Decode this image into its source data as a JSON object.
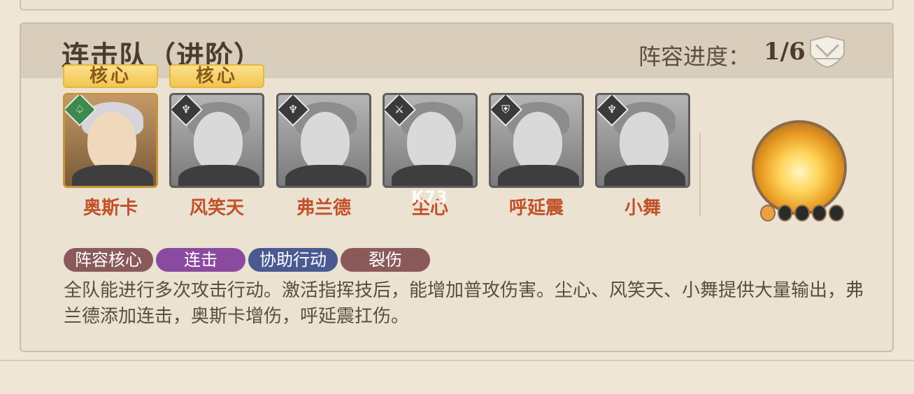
{
  "lineup": {
    "title": "连击队（进阶）",
    "progress_label": "阵容进度：",
    "progress_value": "1/6",
    "badge_icon": "shield-crest-icon"
  },
  "core_tag_label": "核心",
  "heroes": [
    {
      "name": "奥斯卡",
      "active": true,
      "core": true,
      "class_icon": "support-icon"
    },
    {
      "name": "风笑天",
      "active": false,
      "core": true,
      "class_icon": "agility-icon"
    },
    {
      "name": "弗兰德",
      "active": false,
      "core": false,
      "class_icon": "agility-icon"
    },
    {
      "name": "尘心",
      "active": false,
      "core": false,
      "class_icon": "attack-icon"
    },
    {
      "name": "呼延震",
      "active": false,
      "core": false,
      "class_icon": "defense-icon"
    },
    {
      "name": "小舞",
      "active": false,
      "core": false,
      "class_icon": "agility-icon"
    }
  ],
  "emblem": {
    "icon": "flame-wings-icon",
    "level_filled": 1,
    "level_total": 5
  },
  "tags": [
    {
      "label": "阵容核心",
      "color": "#8a5a5a"
    },
    {
      "label": "连击",
      "color": "#8a4aa0"
    },
    {
      "label": "协助行动",
      "color": "#4a5a90"
    },
    {
      "label": "裂伤",
      "color": "#8a5a5a"
    }
  ],
  "description": "全队能进行多次攻击行动。激活指挥技后，能增加普攻伤害。尘心、风笑天、小舞提供大量输出，弗兰德添加连击，奥斯卡增伤，呼延震扛伤。",
  "watermark": "K73"
}
